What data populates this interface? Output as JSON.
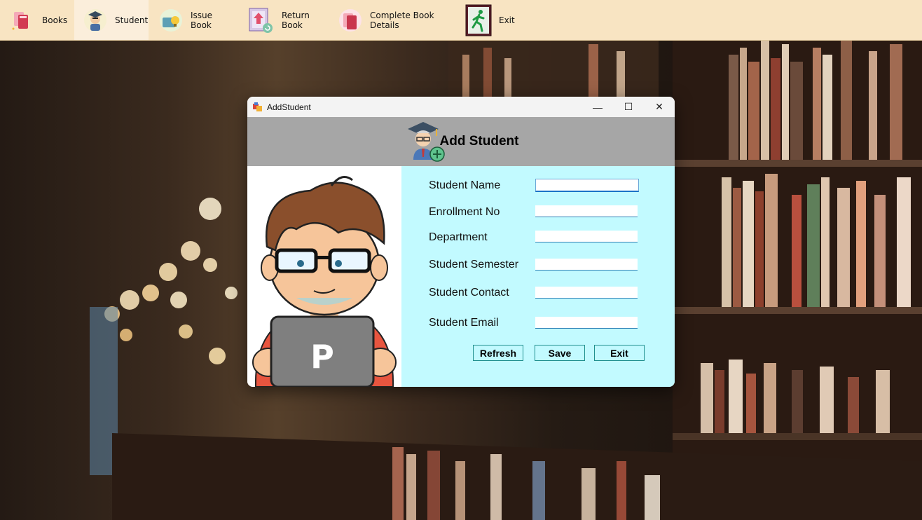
{
  "toolbar": {
    "items": [
      {
        "label": "Books",
        "icon": "books-icon"
      },
      {
        "label": "Student",
        "icon": "graduate-student-icon"
      },
      {
        "label": "Issue Book",
        "icon": "issue-book-icon"
      },
      {
        "label": "Return Book",
        "icon": "return-book-icon"
      },
      {
        "label": "Complete Book Details",
        "icon": "book-details-icon"
      },
      {
        "label": "Exit",
        "icon": "exit-running-man-icon"
      }
    ],
    "active_index": 1
  },
  "dialog": {
    "window_title": "AddStudent",
    "window_controls": {
      "minimize": "—",
      "maximize": "☐",
      "close": "✕"
    },
    "header_title": "Add Student",
    "laptop_letter": "P",
    "form": {
      "fields": [
        {
          "label": "Student Name",
          "value": ""
        },
        {
          "label": "Enrollment No",
          "value": ""
        },
        {
          "label": "Department",
          "value": ""
        },
        {
          "label": "Student Semester",
          "value": ""
        },
        {
          "label": "Student Contact",
          "value": ""
        },
        {
          "label": "Student Email",
          "value": ""
        }
      ]
    },
    "buttons": {
      "refresh": "Refresh",
      "save": "Save",
      "exit": "Exit"
    }
  },
  "colors": {
    "toolbar_bg": "#f8e4c2",
    "header_bg": "#a6a6a6",
    "form_bg": "#c2faff",
    "button_border": "#1f8f8f"
  }
}
